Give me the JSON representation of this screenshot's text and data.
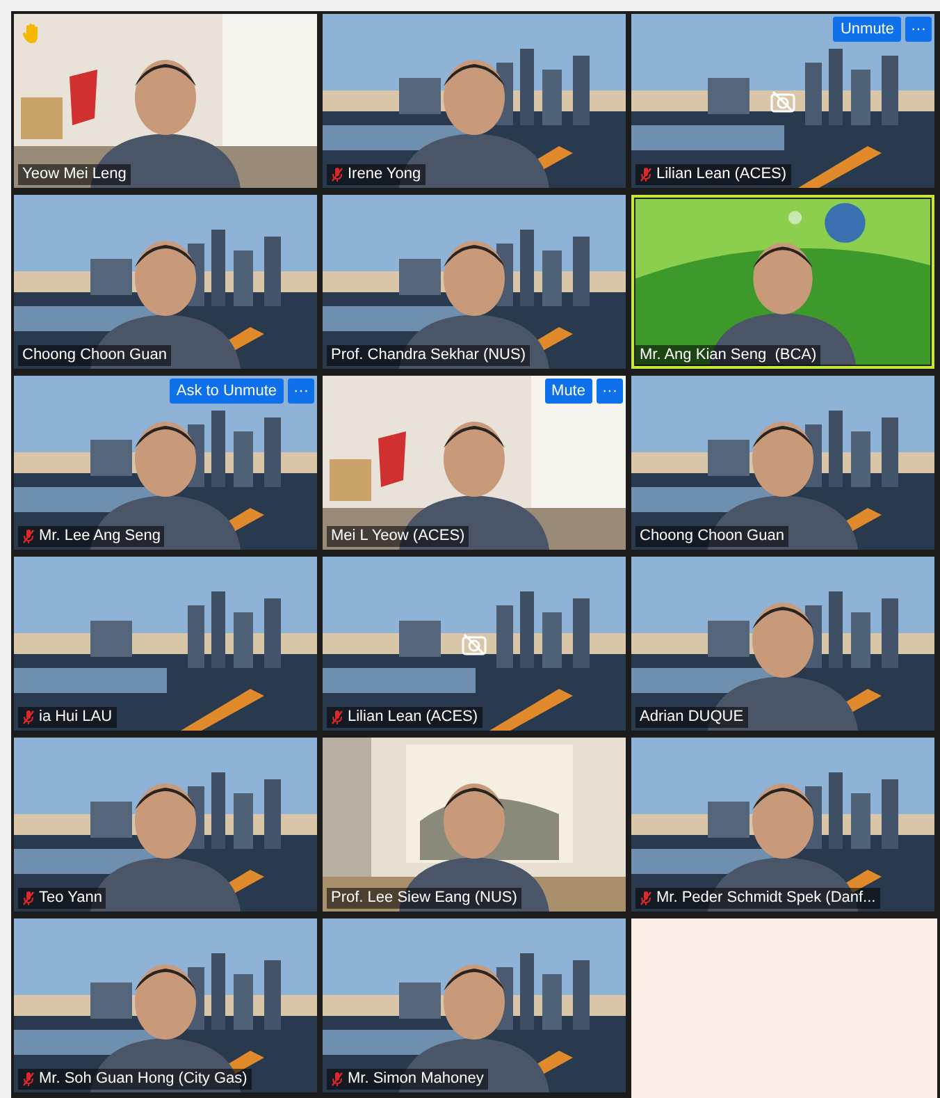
{
  "tiles": [
    {
      "name": "Yeow Mei Leng",
      "camera_off": false,
      "muted": false,
      "hand_raised": true,
      "speaking": false
    },
    {
      "name": "Irene Yong",
      "camera_off": false,
      "muted": true,
      "hand_raised": false,
      "speaking": false
    },
    {
      "name": "Lilian Lean (ACES)",
      "camera_off": true,
      "muted": true,
      "hand_raised": false,
      "speaking": false,
      "buttons": [
        {
          "kind": "label",
          "text": "Unmute"
        },
        {
          "kind": "more",
          "text": "···"
        }
      ]
    },
    {
      "name": "Choong Choon Guan",
      "camera_off": false,
      "muted": false,
      "hand_raised": false,
      "speaking": false
    },
    {
      "name": "Prof. Chandra Sekhar (NUS)",
      "camera_off": false,
      "muted": false,
      "hand_raised": false,
      "speaking": false
    },
    {
      "name": "Mr. Ang Kian Seng  (BCA)",
      "camera_off": false,
      "muted": false,
      "hand_raised": false,
      "speaking": true
    },
    {
      "name": "Mr. Lee Ang Seng",
      "camera_off": false,
      "muted": true,
      "hand_raised": false,
      "speaking": false,
      "buttons": [
        {
          "kind": "label",
          "text": "Ask to Unmute"
        },
        {
          "kind": "more",
          "text": "···"
        }
      ]
    },
    {
      "name": "Mei L Yeow (ACES)",
      "camera_off": false,
      "muted": false,
      "hand_raised": false,
      "speaking": false,
      "buttons": [
        {
          "kind": "label",
          "text": "Mute"
        },
        {
          "kind": "more",
          "text": "···"
        }
      ]
    },
    {
      "name": "Choong Choon Guan",
      "camera_off": false,
      "muted": false,
      "hand_raised": false,
      "speaking": false
    },
    {
      "name": "ia Hui LAU",
      "camera_off": false,
      "muted": true,
      "hand_raised": false,
      "speaking": false
    },
    {
      "name": "Lilian Lean (ACES)",
      "camera_off": true,
      "muted": true,
      "hand_raised": false,
      "speaking": false
    },
    {
      "name": "Adrian DUQUE",
      "camera_off": false,
      "muted": false,
      "hand_raised": false,
      "speaking": false
    },
    {
      "name": "Teo Yann",
      "camera_off": false,
      "muted": true,
      "hand_raised": false,
      "speaking": false
    },
    {
      "name": "Prof. Lee Siew Eang (NUS)",
      "camera_off": false,
      "muted": false,
      "hand_raised": false,
      "speaking": false
    },
    {
      "name": "Mr. Peder Schmidt Spek (Danf...",
      "camera_off": false,
      "muted": true,
      "hand_raised": false,
      "speaking": false
    },
    {
      "name": "Mr. Soh Guan Hong (City Gas)",
      "camera_off": false,
      "muted": true,
      "hand_raised": false,
      "speaking": false
    },
    {
      "name": "Mr. Simon Mahoney",
      "camera_off": false,
      "muted": true,
      "hand_raised": false,
      "speaking": false
    }
  ]
}
